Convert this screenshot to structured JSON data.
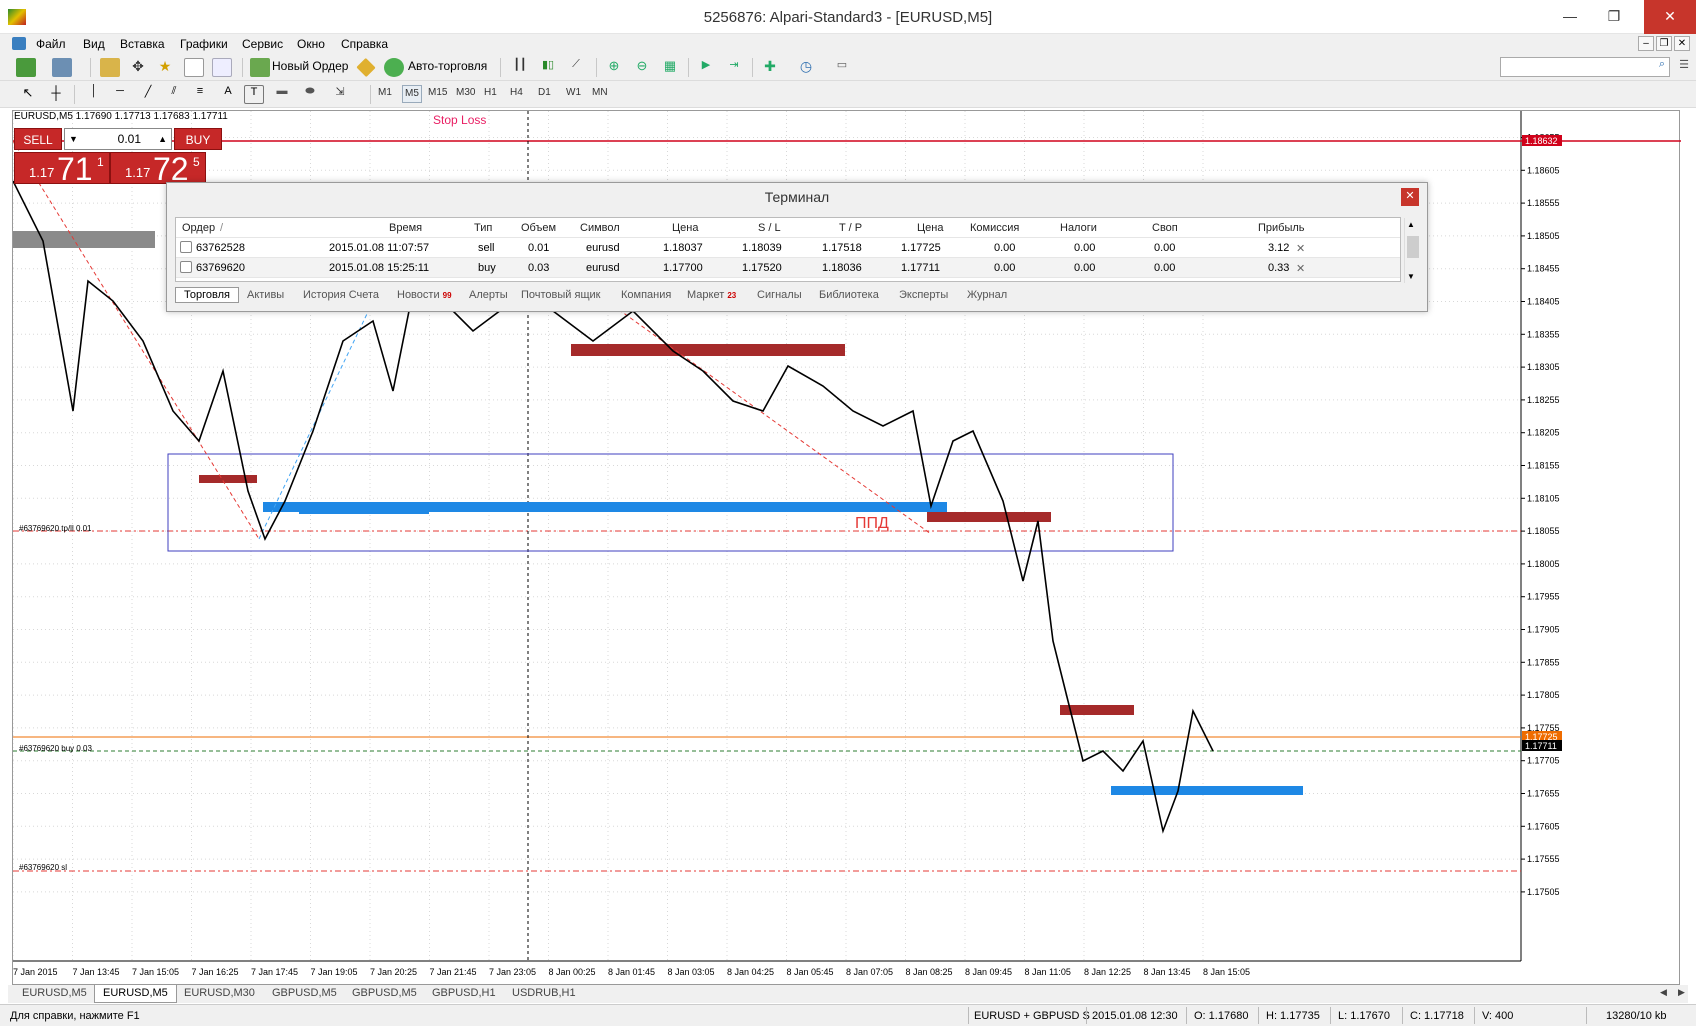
{
  "window": {
    "title": "5256876: Alpari-Standard3 - [EURUSD,M5]"
  },
  "menu": [
    "Файл",
    "Вид",
    "Вставка",
    "Графики",
    "Сервис",
    "Окно",
    "Справка"
  ],
  "toolbar": {
    "new_order": "Новый Ордер",
    "auto_trading": "Авто-торговля",
    "timeframes": [
      "M1",
      "M5",
      "M15",
      "M30",
      "H1",
      "H4",
      "D1",
      "W1",
      "MN"
    ],
    "active_timeframe": "M5",
    "draw_text_tool": "A"
  },
  "chart": {
    "header": "EURUSD,M5  1.17690 1.17713 1.17683 1.17711",
    "stop_loss_label": "Stop Loss",
    "ppd_label": "ППД",
    "tp_line_label": "#63769620 tp/ll 0.01",
    "buy_line_label": "#63769620 buy 0.03",
    "sl_line_label": "#63769620 sl",
    "price_labels": [
      "1.18655",
      "1.18605",
      "1.18555",
      "1.18505",
      "1.18455",
      "1.18405",
      "1.18355",
      "1.18305",
      "1.18255",
      "1.18205",
      "1.18155",
      "1.18105",
      "1.18055",
      "1.18005",
      "1.17955",
      "1.17905",
      "1.17855",
      "1.17805",
      "1.17755",
      "1.17705",
      "1.17655",
      "1.17605",
      "1.17555",
      "1.17505"
    ],
    "marker_red": "1.18632",
    "marker_orange": "1.17725",
    "marker_black": "1.17711",
    "time_labels": [
      "7 Jan 2015",
      "7 Jan 13:45",
      "7 Jan 15:05",
      "7 Jan 16:25",
      "7 Jan 17:45",
      "7 Jan 19:05",
      "7 Jan 20:25",
      "7 Jan 21:45",
      "7 Jan 23:05",
      "8 Jan 00:25",
      "8 Jan 01:45",
      "8 Jan 03:05",
      "8 Jan 04:25",
      "8 Jan 05:45",
      "8 Jan 07:05",
      "8 Jan 08:25",
      "8 Jan 09:45",
      "8 Jan 11:05",
      "8 Jan 12:25",
      "8 Jan 13:45",
      "8 Jan 15:05"
    ]
  },
  "trade_panel": {
    "sell": "SELL",
    "buy": "BUY",
    "lot": "0.01",
    "sell_price_small": "1.17",
    "sell_price_big": "71",
    "sell_price_sup": "1",
    "buy_price_small": "1.17",
    "buy_price_big": "72",
    "buy_price_sup": "5"
  },
  "terminal": {
    "title": "Терминал",
    "columns": [
      "Ордер",
      "Время",
      "Тип",
      "Объем",
      "Символ",
      "Цена",
      "S / L",
      "T / P",
      "Цена",
      "Комиссия",
      "Налоги",
      "Своп",
      "Прибыль"
    ],
    "rows": [
      [
        "63762528",
        "2015.01.08 11:07:57",
        "sell",
        "0.01",
        "eurusd",
        "1.18037",
        "1.18039",
        "1.17518",
        "1.17725",
        "0.00",
        "0.00",
        "0.00",
        "3.12"
      ],
      [
        "63769620",
        "2015.01.08 15:25:11",
        "buy",
        "0.03",
        "eurusd",
        "1.17700",
        "1.17520",
        "1.18036",
        "1.17711",
        "0.00",
        "0.00",
        "0.00",
        "0.33"
      ]
    ],
    "tabs": [
      "Торговля",
      "Активы",
      "История Счета",
      "Новости",
      "Алерты",
      "Почтовый ящик",
      "Компания",
      "Маркет",
      "Сигналы",
      "Библиотека",
      "Эксперты",
      "Журнал"
    ],
    "news_badge": "99",
    "market_badge": "23"
  },
  "symbol_tabs": [
    "EURUSD,M5",
    "EURUSD,M5",
    "EURUSD,M30",
    "GBPUSD,M5",
    "GBPUSD,M5",
    "GBPUSD,H1",
    "USDRUB,H1"
  ],
  "status": {
    "help": "Для справки, нажмите F1",
    "profile": "EURUSD + GBPUSD S",
    "datetime": "2015.01.08 12:30",
    "open": "O: 1.17680",
    "high": "H: 1.17735",
    "low": "L: 1.17670",
    "close": "C: 1.17718",
    "volume": "V: 400",
    "traffic": "13280/10 kb"
  }
}
